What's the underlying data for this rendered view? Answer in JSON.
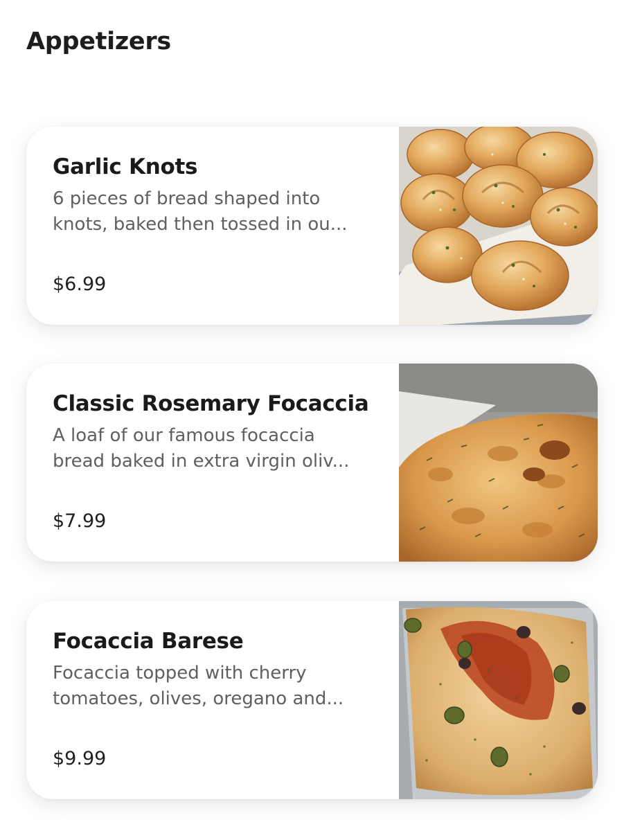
{
  "section": {
    "title": "Appetizers"
  },
  "items": [
    {
      "name": "Garlic Knots",
      "description": "6 pieces of bread shaped into\nknots, baked then tossed in ou...",
      "price": "$6.99",
      "image_icon": "garlic-knots-photo"
    },
    {
      "name": "Classic Rosemary Focaccia",
      "description": "A loaf of our famous focaccia\nbread baked in extra virgin oliv...",
      "price": "$7.99",
      "image_icon": "rosemary-focaccia-photo"
    },
    {
      "name": "Focaccia Barese",
      "description": "Focaccia topped with cherry\ntomatoes, olives, oregano and...",
      "price": "$9.99",
      "image_icon": "focaccia-barese-photo"
    }
  ],
  "colors": {
    "title_text": "#1d1d1d",
    "description_text": "#5f5f5f",
    "card_background": "#ffffff"
  }
}
